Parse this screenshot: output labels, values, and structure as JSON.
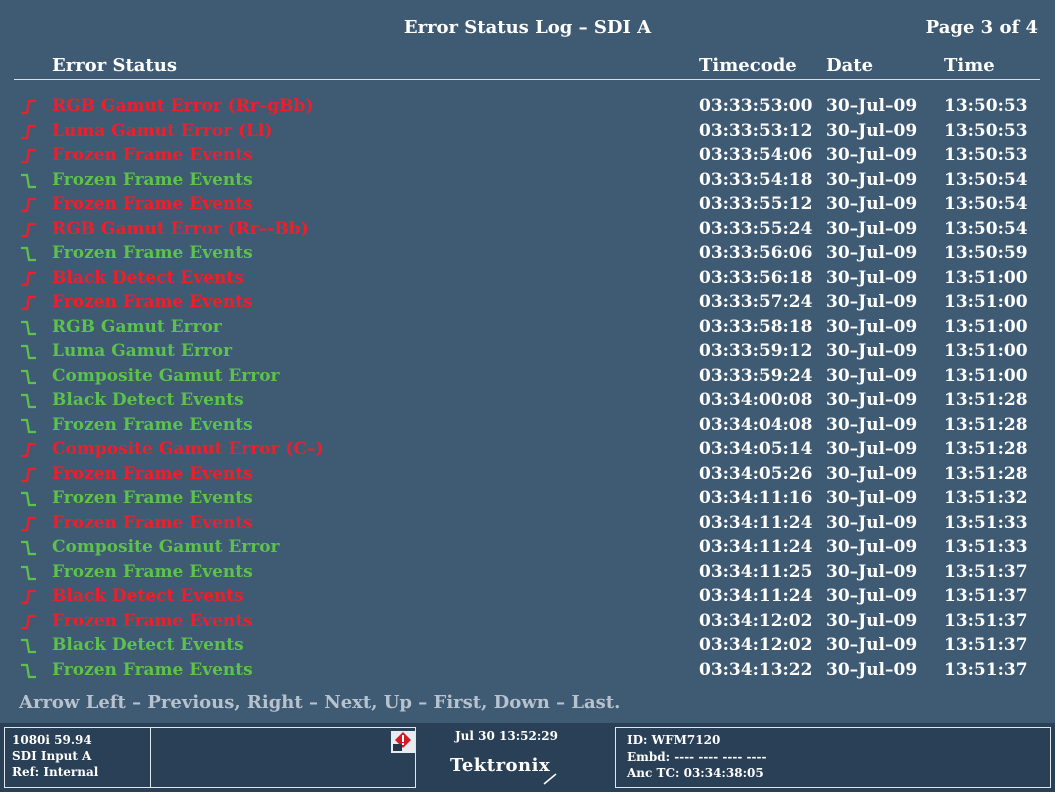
{
  "header": {
    "title": "Error Status Log – SDI A",
    "page": "Page 3 of 4"
  },
  "columns": {
    "status": "Error Status",
    "timecode": "Timecode",
    "date": "Date",
    "time": "Time"
  },
  "rows": [
    {
      "status": "RGB Gamut Error (Rr–gBb)",
      "timecode": "03:33:53:00",
      "date": "30–Jul–09",
      "time": "13:50:53",
      "state": "error"
    },
    {
      "status": "Luma Gamut Error (Ll)",
      "timecode": "03:33:53:12",
      "date": "30–Jul–09",
      "time": "13:50:53",
      "state": "error"
    },
    {
      "status": "Frozen Frame Events",
      "timecode": "03:33:54:06",
      "date": "30–Jul–09",
      "time": "13:50:53",
      "state": "error"
    },
    {
      "status": "Frozen Frame Events",
      "timecode": "03:33:54:18",
      "date": "30–Jul–09",
      "time": "13:50:54",
      "state": "clear"
    },
    {
      "status": "Frozen Frame Events",
      "timecode": "03:33:55:12",
      "date": "30–Jul–09",
      "time": "13:50:54",
      "state": "error"
    },
    {
      "status": "RGB Gamut Error (Rr–-Bb)",
      "timecode": "03:33:55:24",
      "date": "30–Jul–09",
      "time": "13:50:54",
      "state": "error"
    },
    {
      "status": "Frozen Frame Events",
      "timecode": "03:33:56:06",
      "date": "30–Jul–09",
      "time": "13:50:59",
      "state": "clear"
    },
    {
      "status": "Black Detect Events",
      "timecode": "03:33:56:18",
      "date": "30–Jul–09",
      "time": "13:51:00",
      "state": "error"
    },
    {
      "status": "Frozen Frame Events",
      "timecode": "03:33:57:24",
      "date": "30–Jul–09",
      "time": "13:51:00",
      "state": "error"
    },
    {
      "status": "RGB Gamut Error",
      "timecode": "03:33:58:18",
      "date": "30–Jul–09",
      "time": "13:51:00",
      "state": "clear"
    },
    {
      "status": "Luma Gamut Error",
      "timecode": "03:33:59:12",
      "date": "30–Jul–09",
      "time": "13:51:00",
      "state": "clear"
    },
    {
      "status": "Composite Gamut Error",
      "timecode": "03:33:59:24",
      "date": "30–Jul–09",
      "time": "13:51:00",
      "state": "clear"
    },
    {
      "status": "Black Detect Events",
      "timecode": "03:34:00:08",
      "date": "30–Jul–09",
      "time": "13:51:28",
      "state": "clear"
    },
    {
      "status": "Frozen Frame Events",
      "timecode": "03:34:04:08",
      "date": "30–Jul–09",
      "time": "13:51:28",
      "state": "clear"
    },
    {
      "status": "Composite Gamut Error (C–)",
      "timecode": "03:34:05:14",
      "date": "30–Jul–09",
      "time": "13:51:28",
      "state": "error"
    },
    {
      "status": "Frozen Frame Events",
      "timecode": "03:34:05:26",
      "date": "30–Jul–09",
      "time": "13:51:28",
      "state": "error"
    },
    {
      "status": "Frozen Frame Events",
      "timecode": "03:34:11:16",
      "date": "30–Jul–09",
      "time": "13:51:32",
      "state": "clear"
    },
    {
      "status": "Frozen Frame Events",
      "timecode": "03:34:11:24",
      "date": "30–Jul–09",
      "time": "13:51:33",
      "state": "error"
    },
    {
      "status": "Composite Gamut Error",
      "timecode": "03:34:11:24",
      "date": "30–Jul–09",
      "time": "13:51:33",
      "state": "clear"
    },
    {
      "status": "Frozen Frame Events",
      "timecode": "03:34:11:25",
      "date": "30–Jul–09",
      "time": "13:51:37",
      "state": "clear"
    },
    {
      "status": "Black Detect Events",
      "timecode": "03:34:11:24",
      "date": "30–Jul–09",
      "time": "13:51:37",
      "state": "error"
    },
    {
      "status": "Frozen Frame Events",
      "timecode": "03:34:12:02",
      "date": "30–Jul–09",
      "time": "13:51:37",
      "state": "error"
    },
    {
      "status": "Black Detect Events",
      "timecode": "03:34:12:02",
      "date": "30–Jul–09",
      "time": "13:51:37",
      "state": "clear"
    },
    {
      "status": "Frozen Frame Events",
      "timecode": "03:34:13:22",
      "date": "30–Jul–09",
      "time": "13:51:37",
      "state": "clear"
    }
  ],
  "nav_hint": "Arrow Left – Previous, Right – Next, Up – First, Down – Last.",
  "status_bar": {
    "format": [
      "1080i 59.94",
      "SDI Input A",
      "Ref: Internal"
    ],
    "alarm_icon": "alarm-warning-icon",
    "clock": "Jul 30 13:52:29",
    "brand": "Tektronix",
    "id": [
      "ID: WFM7120",
      "Embd: ---- ---- ---- ----",
      "Anc TC: 03:34:38:05"
    ]
  },
  "colors": {
    "background": "#3f5a73",
    "error": "#f01e2a",
    "clear": "#5cc24c",
    "hint": "#b7c2cf"
  },
  "icons": {
    "error_edge": "rising-edge-icon",
    "clear_edge": "falling-edge-icon"
  }
}
